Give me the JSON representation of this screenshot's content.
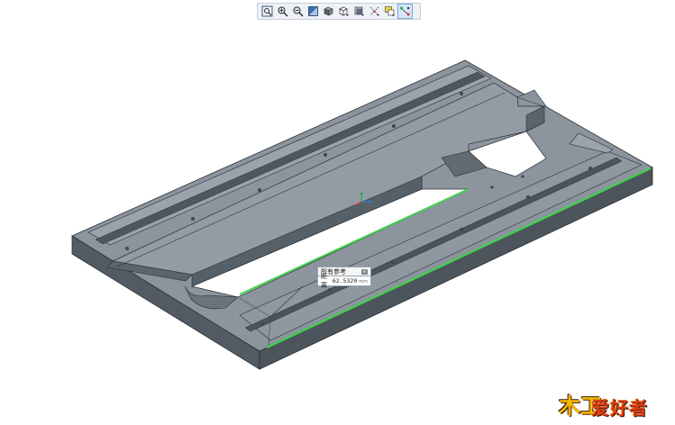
{
  "toolbar": {
    "buttons": [
      {
        "icon": "zoom-fit-icon",
        "active": false
      },
      {
        "icon": "zoom-in-icon",
        "active": false
      },
      {
        "icon": "zoom-out-icon",
        "active": false
      },
      {
        "icon": "repaint-icon",
        "active": false
      },
      {
        "icon": "display-style-icon",
        "active": false
      },
      {
        "icon": "saved-views-icon",
        "active": false
      },
      {
        "icon": "section-icon",
        "active": false
      },
      {
        "icon": "datum-display-icon",
        "active": false
      },
      {
        "icon": "annotation-display-icon",
        "active": false
      },
      {
        "icon": "spin-center-icon",
        "active": true
      }
    ]
  },
  "colors": {
    "face_top": "#8c959e",
    "face_side": "#525a63",
    "face_dark": "#3f464e",
    "edge": "#2a2f35",
    "highlight": "#3fd14a",
    "background": "#ffffff"
  },
  "measure_callout": {
    "title": "所有参考",
    "label": "距离",
    "value": "62.5320",
    "unit": "mm"
  },
  "watermark": {
    "mark": "木工",
    "text": "爱好者"
  }
}
